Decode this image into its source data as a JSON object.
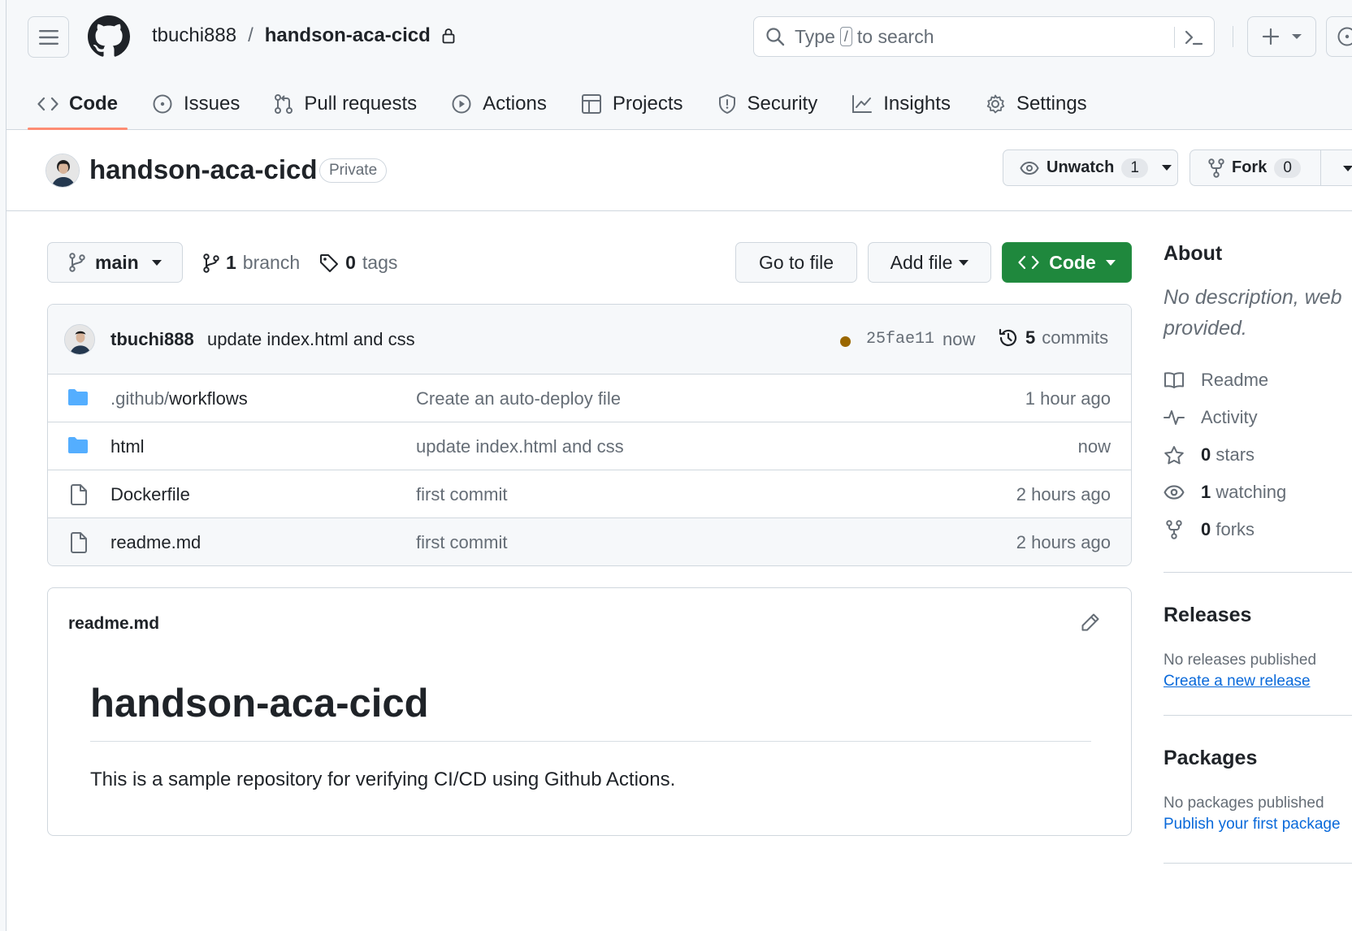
{
  "header": {
    "owner": "tbuchi888",
    "separator": "/",
    "repo": "handson-aca-cicd",
    "search_prefix": "Type",
    "search_key": "/",
    "search_suffix": "to search"
  },
  "tabs": [
    {
      "label": "Code",
      "icon": "code-icon",
      "selected": true
    },
    {
      "label": "Issues",
      "icon": "issue-icon"
    },
    {
      "label": "Pull requests",
      "icon": "pull-request-icon"
    },
    {
      "label": "Actions",
      "icon": "play-icon"
    },
    {
      "label": "Projects",
      "icon": "table-icon"
    },
    {
      "label": "Security",
      "icon": "shield-icon"
    },
    {
      "label": "Insights",
      "icon": "graph-icon"
    },
    {
      "label": "Settings",
      "icon": "gear-icon"
    }
  ],
  "repo": {
    "title": "handson-aca-cicd",
    "visibility": "Private",
    "unwatch_label": "Unwatch",
    "watch_count": "1",
    "fork_label": "Fork",
    "fork_count": "0"
  },
  "filenav": {
    "branch": "main",
    "branch_count": "1",
    "branch_label": "branch",
    "tag_count": "0",
    "tag_label": "tags",
    "goto_label": "Go to file",
    "addfile_label": "Add file",
    "code_label": "Code"
  },
  "latest_commit": {
    "author": "tbuchi888",
    "message": "update index.html and css",
    "status_color": "#9a6700",
    "sha": "25fae11",
    "when": "now",
    "commit_count": "5",
    "commit_label": "commits"
  },
  "files": [
    {
      "type": "folder",
      "name_dim": ".github/",
      "name": "workflows",
      "message": "Create an auto-deploy file",
      "time": "1 hour ago"
    },
    {
      "type": "folder",
      "name_dim": "",
      "name": "html",
      "message": "update index.html and css",
      "time": "now"
    },
    {
      "type": "file",
      "name_dim": "",
      "name": "Dockerfile",
      "message": "first commit",
      "time": "2 hours ago"
    },
    {
      "type": "file",
      "name_dim": "",
      "name": "readme.md",
      "message": "first commit",
      "time": "2 hours ago"
    }
  ],
  "readme": {
    "filename": "readme.md",
    "heading": "handson-aca-cicd",
    "body": "This is a sample repository for verifying CI/CD using Github Actions."
  },
  "about": {
    "title": "About",
    "description_line1": "No description, web",
    "description_line2": "provided.",
    "links": [
      {
        "icon": "book-icon",
        "bold": "",
        "label": "Readme"
      },
      {
        "icon": "pulse-icon",
        "bold": "",
        "label": "Activity"
      },
      {
        "icon": "star-icon",
        "bold": "0",
        "label": "stars"
      },
      {
        "icon": "eye-icon",
        "bold": "1",
        "label": "watching"
      },
      {
        "icon": "fork-icon",
        "bold": "0",
        "label": "forks"
      }
    ]
  },
  "releases": {
    "title": "Releases",
    "empty": "No releases published",
    "link": "Create a new release"
  },
  "packages": {
    "title": "Packages",
    "empty": "No packages published",
    "link": "Publish your first package"
  },
  "colors": {
    "accent_underline": "#fd8c73",
    "primary_button": "#1f883d",
    "link": "#0969da",
    "folder": "#54aeff"
  }
}
